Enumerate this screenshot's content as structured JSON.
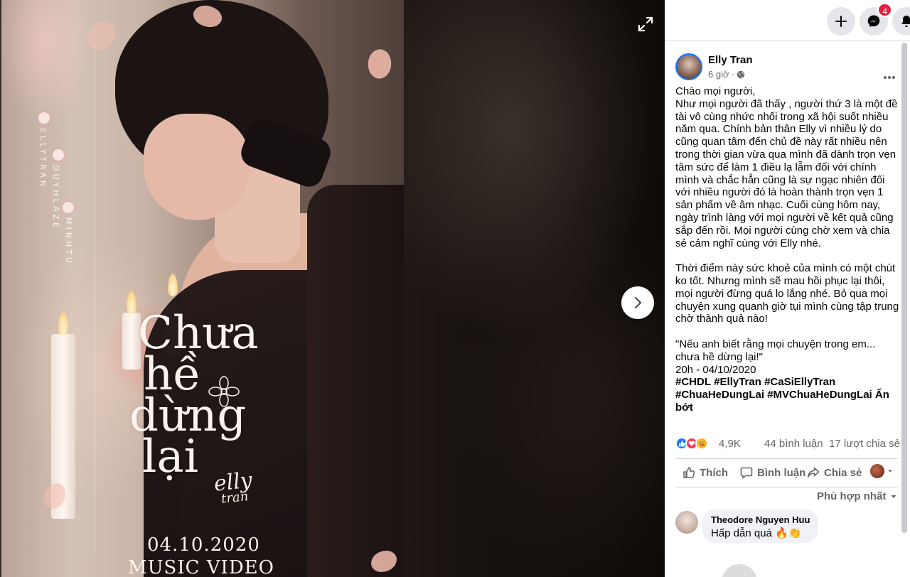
{
  "viewer": {
    "poster": {
      "title_lines": [
        "Chưa",
        "hề",
        "dừng",
        "lại"
      ],
      "signature_main": "elly",
      "signature_sub": "tran",
      "date": "04.10.2020",
      "subtitle": "MUSIC VIDEO",
      "credits_left": "ELLYTRAN",
      "credits_mid": "DUYHLAZE",
      "credits_right": "MINHTU"
    }
  },
  "topbar": {
    "messenger_badge": "4"
  },
  "post": {
    "author": "Elly Tran",
    "time": "6 giờ ·",
    "body": "Chào mọi người,\nNhư mọi người đã thấy , người thứ 3 là một đề tài vô cùng nhức nhối trong xã hội suốt nhiều năm qua. Chính bản thân Elly vì nhiều lý do cũng quan tâm đến chủ đề này rất nhiều nên trong thời gian vừa qua mình đã dành trọn vẹn tâm sức để làm 1 điều lạ lẫm đối với chính mình và chắc hẳn cũng là sự ngạc nhiên đối với nhiều người đó là hoàn thành trọn vẹn 1 sản phẩm về âm nhạc. Cuối cùng hôm nay, ngày trình làng với mọi người về kết quả cũng sắp đến rồi. Mọi người cùng chờ xem và chia sẻ cảm nghĩ cùng với Elly nhé.\n\nThời điểm này sức khoẻ của mình có một chút ko tốt. Nhưng mình sẽ mau hồi phục lại thôi, mọi người đừng quá lo lắng nhé. Bỏ qua mọi chuyện xung quanh giờ tụi mình cùng tập trung chờ thành quả nào!\n\n\"Nếu anh biết rằng mọi chuyện trong em... chưa hề dừng lại!\"\n20h - 04/10/2020",
    "hashtags": [
      "#CHDL",
      "#EllyTran",
      "#CaSiEllyTran",
      "#ChuaHeDungLai",
      "#MVChuaHeDungLai"
    ],
    "see_less": "Ẩn bớt",
    "reaction_count": "4,9K",
    "comment_count": "44 bình luận",
    "share_count": "17 lượt chia sẻ",
    "actions": {
      "like": "Thích",
      "comment": "Bình luận",
      "share": "Chia sẻ"
    },
    "sort_label": "Phù hợp nhất",
    "comments": [
      {
        "author": "Theodore Nguyen Huu",
        "text": "Hấp dẫn quá 🔥👏"
      }
    ]
  },
  "colors": {
    "brand_blue": "#1877f2",
    "badge_red": "#e41e3f",
    "secondary_text": "#65676b"
  }
}
